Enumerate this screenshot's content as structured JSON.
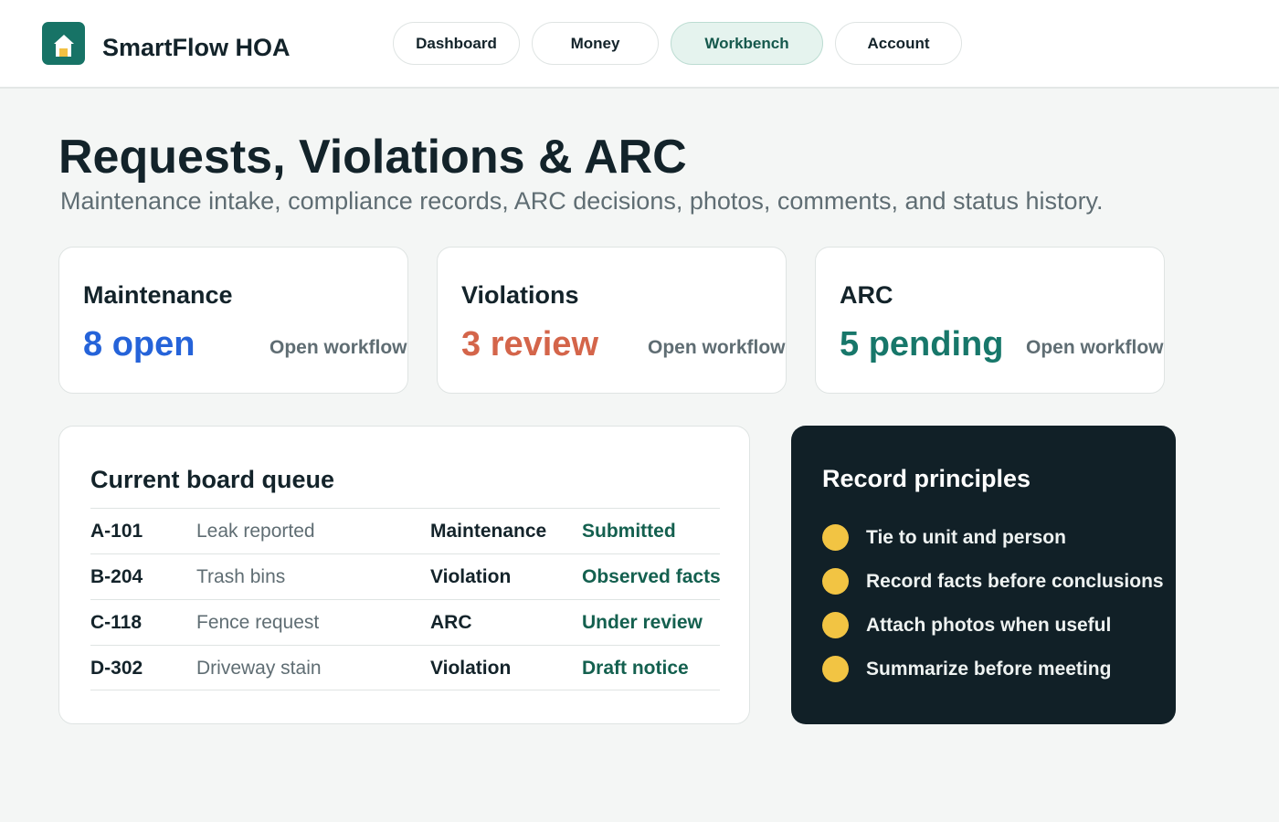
{
  "app": {
    "brand": "SmartFlow HOA",
    "logo_icon": "house-icon",
    "accent_color": "#177366"
  },
  "nav": {
    "items": [
      {
        "label": "Dashboard",
        "active": false
      },
      {
        "label": "Money",
        "active": false
      },
      {
        "label": "Workbench",
        "active": true
      },
      {
        "label": "Account",
        "active": false
      }
    ]
  },
  "page": {
    "title": "Requests, Violations & ARC",
    "subtitle": "Maintenance intake, compliance records, ARC decisions, photos, comments, and status history."
  },
  "stats": [
    {
      "title": "Maintenance",
      "value": "8 open",
      "link": "Open workflow",
      "color": "#2563d9"
    },
    {
      "title": "Violations",
      "value": "3 review",
      "link": "Open workflow",
      "color": "#d4654a"
    },
    {
      "title": "ARC",
      "value": "5 pending",
      "link": "Open workflow",
      "color": "#17776a"
    }
  ],
  "queue": {
    "title": "Current board queue",
    "rows": [
      {
        "id": "A-101",
        "description": "Leak reported",
        "type": "Maintenance",
        "status": "Submitted"
      },
      {
        "id": "B-204",
        "description": "Trash bins",
        "type": "Violation",
        "status": "Observed facts"
      },
      {
        "id": "C-118",
        "description": "Fence request",
        "type": "ARC",
        "status": "Under review"
      },
      {
        "id": "D-302",
        "description": "Driveway stain",
        "type": "Violation",
        "status": "Draft notice"
      }
    ]
  },
  "principles": {
    "title": "Record principles",
    "dot_color": "#f2c443",
    "items": [
      "Tie to unit and person",
      "Record facts before conclusions",
      "Attach photos when useful",
      "Summarize before meeting"
    ]
  }
}
